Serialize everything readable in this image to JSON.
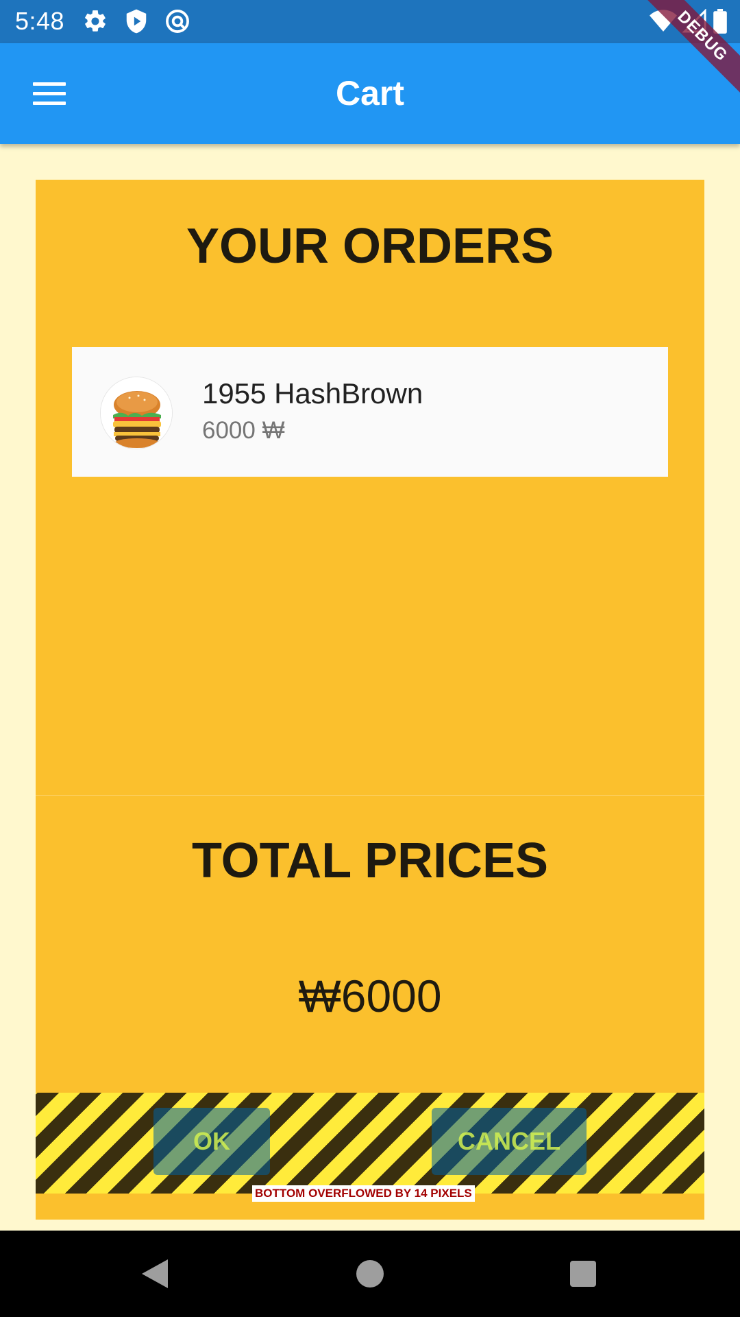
{
  "status_bar": {
    "time": "5:48",
    "left_icons": [
      "gear-icon",
      "shield-play-icon",
      "at-sync-icon"
    ],
    "right_icons": [
      "wifi-icon",
      "signal-icon",
      "battery-icon"
    ]
  },
  "debug_banner": {
    "label": "DEBUG"
  },
  "app_bar": {
    "menu_icon": "hamburger-menu-icon",
    "title": "Cart"
  },
  "orders": {
    "title": "YOUR ORDERS",
    "items": [
      {
        "name": "1955 HashBrown",
        "price": "6000 ₩",
        "image": "burger-thumbnail"
      }
    ]
  },
  "totals": {
    "title": "TOTAL PRICES",
    "value": "₩6000"
  },
  "actions": {
    "ok_label": "OK",
    "cancel_label": "CANCEL",
    "overflow_warning": "BOTTOM OVERFLOWED BY 14 PIXELS"
  },
  "nav_bar": {
    "icons": [
      "back-triangle-icon",
      "home-circle-icon",
      "recent-square-icon"
    ]
  },
  "colors": {
    "status_bar": "#1E74BD",
    "app_bar": "#2196F3",
    "background": "#FFF8CE",
    "card": "#FBC02D",
    "item_card": "#FAFAFA",
    "overflow_stripe_yellow": "#FFEB3B",
    "overflow_stripe_dark": "#3A2F0F",
    "debug_ribbon": "#83173A"
  }
}
